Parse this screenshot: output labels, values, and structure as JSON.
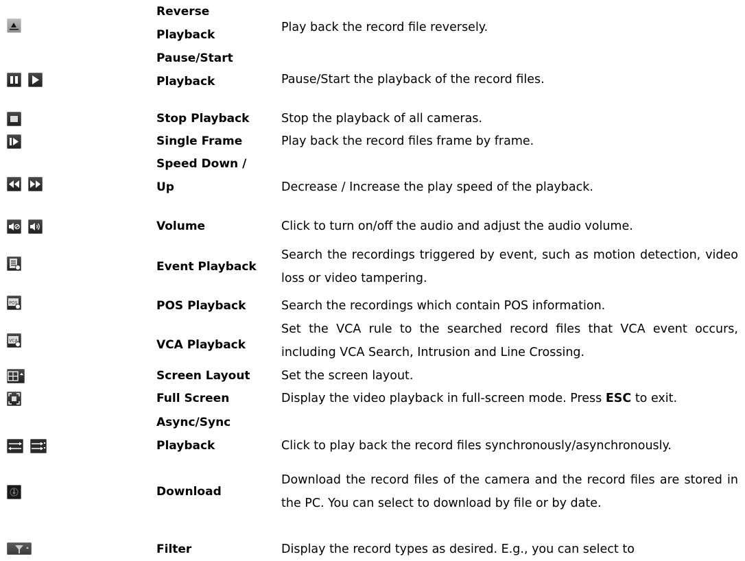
{
  "rows": [
    {
      "name": "Reverse Playback",
      "desc": "Play back the record file reversely.",
      "icons": [
        "reverse-playback-icon"
      ]
    },
    {
      "name": "Pause/Start Playback",
      "desc": "Pause/Start the playback of the record files.",
      "icons": [
        "pause-icon",
        "play-icon"
      ]
    },
    {
      "name": "Stop Playback",
      "desc": "Stop the playback of all cameras.",
      "icons": [
        "stop-icon"
      ]
    },
    {
      "name": "Single Frame",
      "desc": "Play back the record files frame by frame.",
      "icons": [
        "single-frame-icon"
      ]
    },
    {
      "name": "Speed Down / Up",
      "desc": "Decrease / Increase the play speed of the playback.",
      "icons": [
        "speed-down-icon",
        "speed-up-icon"
      ]
    },
    {
      "name": "Volume",
      "desc": "Click to turn on/off the audio and adjust the audio volume.",
      "icons": [
        "mute-icon",
        "volume-icon"
      ]
    },
    {
      "name": "Event Playback",
      "desc": "Search the recordings triggered by event, such as motion detection, video loss or video tampering.",
      "icons": [
        "event-playback-icon"
      ]
    },
    {
      "name": "POS Playback",
      "desc": "Search the recordings which contain POS information.",
      "icons": [
        "pos-playback-icon"
      ]
    },
    {
      "name": "VCA Playback",
      "desc": "Set the VCA rule to the searched record files that VCA event occurs, including VCA Search, Intrusion and Line Crossing.",
      "icons": [
        "vca-playback-icon"
      ]
    },
    {
      "name": "Screen Layout",
      "desc": "Set the screen layout.",
      "icons": [
        "screen-layout-icon"
      ]
    },
    {
      "name": "Full Screen",
      "desc_before": "Display the video playback in full-screen mode. Press ",
      "desc_bold": "ESC",
      "desc_after": " to exit.",
      "icons": [
        "full-screen-icon"
      ]
    },
    {
      "name": "Async/Sync Playback",
      "desc": "Click to play back the record files synchronously/asynchronously.",
      "icons": [
        "async-icon",
        "sync-icon"
      ]
    },
    {
      "name": "Download",
      "desc": "Download the record files of the camera and the record files are stored in the PC. You can select to download by file or by date.",
      "icons": [
        "download-icon"
      ]
    },
    {
      "name": "Filter",
      "desc": "Display the record types as desired. E.g., you can select to",
      "icons": [
        "filter-icon"
      ]
    }
  ],
  "icon_text": {
    "pos": "POS",
    "vca": "VCA"
  }
}
